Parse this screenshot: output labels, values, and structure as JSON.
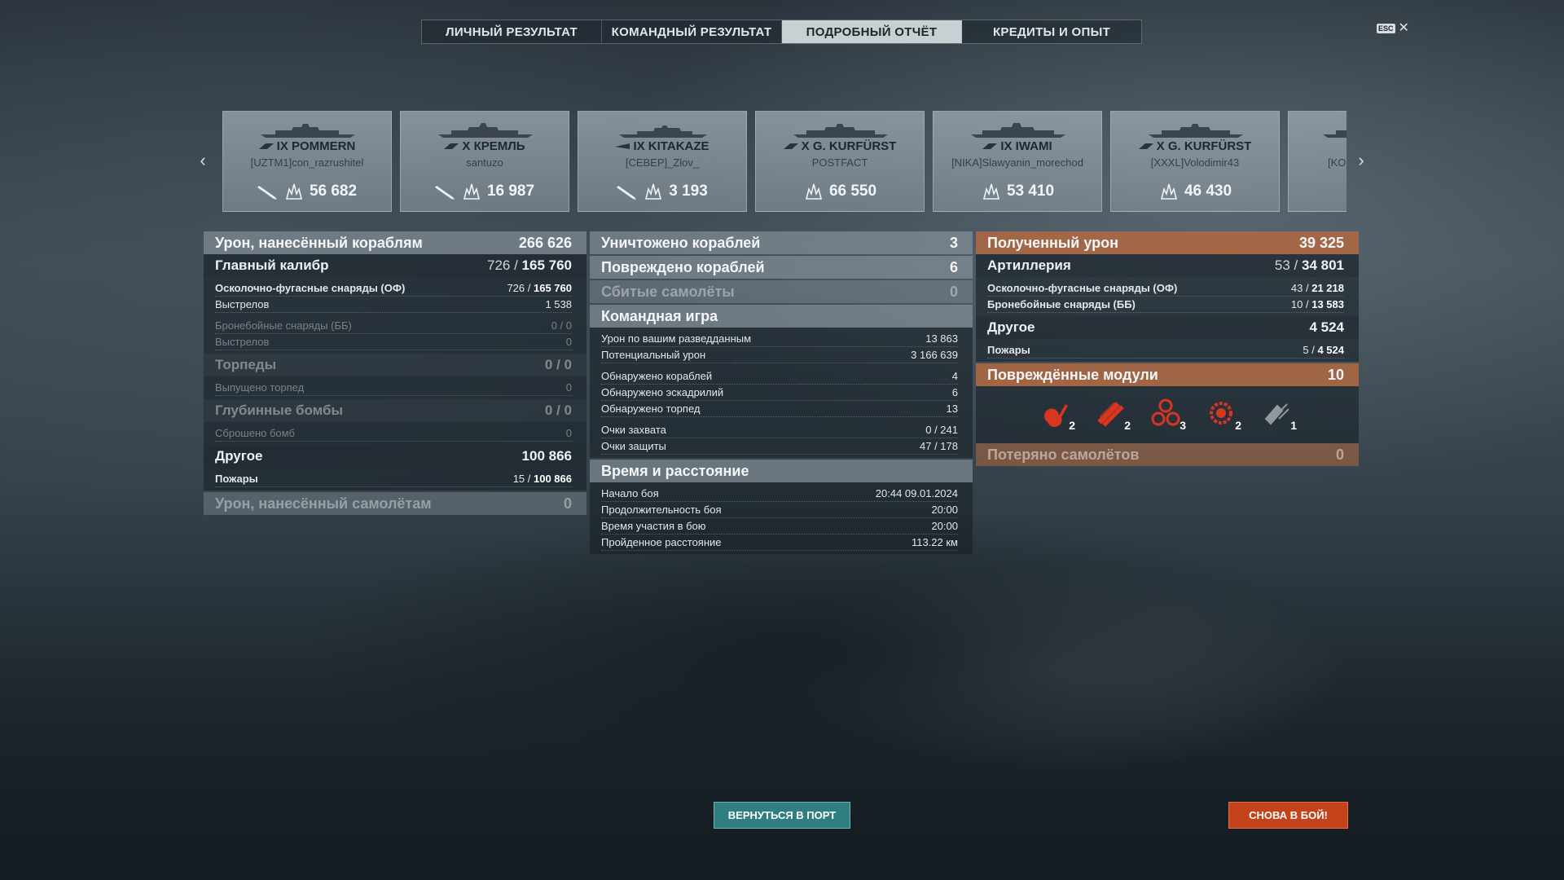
{
  "tabs": [
    {
      "label": "ЛИЧНЫЙ РЕЗУЛЬТАТ",
      "active": false
    },
    {
      "label": "КОМАНДНЫЙ РЕЗУЛЬТАТ",
      "active": false
    },
    {
      "label": "ПОДРОБНЫЙ ОТЧЁТ",
      "active": true
    },
    {
      "label": "КРЕДИТЫ И ОПЫТ",
      "active": false
    }
  ],
  "esc": {
    "key": "ESC",
    "close": "✕"
  },
  "carousel": {
    "prev": "‹",
    "next": "›",
    "cards": [
      {
        "tier_name": "IX POMMERN",
        "player": "[UZTM1]con_razrushitel",
        "damage": "56 682",
        "torpedo_icon": true
      },
      {
        "tier_name": "X КРЕМЛЬ",
        "player": "santuzo",
        "damage": "16 987",
        "torpedo_icon": true
      },
      {
        "tier_name": "IX KITAKAZE",
        "player": "[СЕВЕР]_Zlov_",
        "damage": "3 193",
        "torpedo_icon": true
      },
      {
        "tier_name": "X G. KURFÜRST",
        "player": "POSTFACT",
        "damage": "66 550",
        "torpedo_icon": false
      },
      {
        "tier_name": "IX IWAMI",
        "player": "[NIKA]Slawyanin_morechod",
        "damage": "53 410",
        "torpedo_icon": false
      },
      {
        "tier_name": "X G. KURFÜRST",
        "player": "[XXXL]Volodimir43",
        "damage": "46 430",
        "torpedo_icon": false
      },
      {
        "tier_name": "",
        "player": "[KO",
        "damage": "",
        "torpedo_icon": false
      }
    ]
  },
  "left": {
    "damage_ships": {
      "label": "Урон, нанесённый кораблям",
      "value": "266 626"
    },
    "main_caliber": {
      "label": "Главный калибр",
      "hits": "726",
      "dmg": "165 760"
    },
    "he": {
      "label": "Осколочно-фугасные снаряды (ОФ)",
      "hits": "726",
      "dmg": "165 760"
    },
    "he_shots": {
      "label": "Выстрелов",
      "value": "1 538"
    },
    "ap": {
      "label": "Бронебойные снаряды (ББ)",
      "value": "0 / 0"
    },
    "ap_shots": {
      "label": "Выстрелов",
      "value": "0"
    },
    "torpedoes": {
      "label": "Торпеды",
      "value": "0 / 0"
    },
    "torps_fired": {
      "label": "Выпущено торпед",
      "value": "0"
    },
    "depth": {
      "label": "Глубинные бомбы",
      "value": "0 / 0"
    },
    "bombs_dropped": {
      "label": "Сброшено бомб",
      "value": "0"
    },
    "other": {
      "label": "Другое",
      "value": "100 866"
    },
    "fires": {
      "label": "Пожары",
      "hits": "15",
      "dmg": "100 866"
    },
    "damage_planes": {
      "label": "Урон, нанесённый самолётам",
      "value": "0"
    }
  },
  "middle": {
    "destroyed": {
      "label": "Уничтожено кораблей",
      "value": "3"
    },
    "damaged": {
      "label": "Повреждено кораблей",
      "value": "6"
    },
    "planes_down": {
      "label": "Сбитые самолёты",
      "value": "0"
    },
    "team": {
      "label": "Командная игра"
    },
    "spot_dmg": {
      "label": "Урон по вашим разведданным",
      "value": "13 863"
    },
    "potential": {
      "label": "Потенциальный урон",
      "value": "3 166 639"
    },
    "spot_ships": {
      "label": "Обнаружено кораблей",
      "value": "4"
    },
    "spot_squads": {
      "label": "Обнаружено эскадрилий",
      "value": "6"
    },
    "spot_torps": {
      "label": "Обнаружено торпед",
      "value": "13"
    },
    "capture": {
      "label": "Очки захвата",
      "value": "0 / 241"
    },
    "defense": {
      "label": "Очки защиты",
      "value": "47 / 178"
    },
    "time": {
      "label": "Время и расстояние"
    },
    "start": {
      "label": "Начало боя",
      "value": "20:44  09.01.2024"
    },
    "duration": {
      "label": "Продолжительность боя",
      "value": "20:00"
    },
    "participation": {
      "label": "Время участия в бою",
      "value": "20:00"
    },
    "distance": {
      "label": "Пройденное расстояние",
      "value": "113.22 км"
    }
  },
  "right": {
    "received": {
      "label": "Полученный урон",
      "value": "39 325"
    },
    "artillery": {
      "label": "Артиллерия",
      "hits": "53",
      "dmg": "34 801"
    },
    "he": {
      "label": "Осколочно-фугасные снаряды (ОФ)",
      "hits": "43",
      "dmg": "21 218"
    },
    "ap": {
      "label": "Бронебойные снаряды (ББ)",
      "hits": "10",
      "dmg": "13 583"
    },
    "other": {
      "label": "Другое",
      "value": "4 524"
    },
    "fires": {
      "label": "Пожары",
      "hits": "5",
      "dmg": "4 524"
    },
    "modules": {
      "label": "Повреждённые модули",
      "value": "10"
    },
    "module_counts": [
      {
        "name": "engine-module-icon",
        "count": "2",
        "color": "#d8361f"
      },
      {
        "name": "torpedo-tubes-module-icon",
        "count": "2",
        "color": "#d8361f"
      },
      {
        "name": "steering-module-icon",
        "count": "3",
        "color": "#d8361f"
      },
      {
        "name": "main-battery-module-icon",
        "count": "2",
        "color": "#d8361f"
      },
      {
        "name": "secondary-module-icon",
        "count": "1",
        "color": "#9aa3a8"
      }
    ],
    "planes_lost": {
      "label": "Потеряно самолётов",
      "value": "0"
    }
  },
  "buttons": {
    "port": "ВЕРНУТЬСЯ В ПОРТ",
    "battle": "СНОВА В БОЙ!"
  },
  "colors": {
    "accent_orange": "#b06840",
    "port_button": "#2f7e80",
    "battle_button": "#c4431b"
  }
}
